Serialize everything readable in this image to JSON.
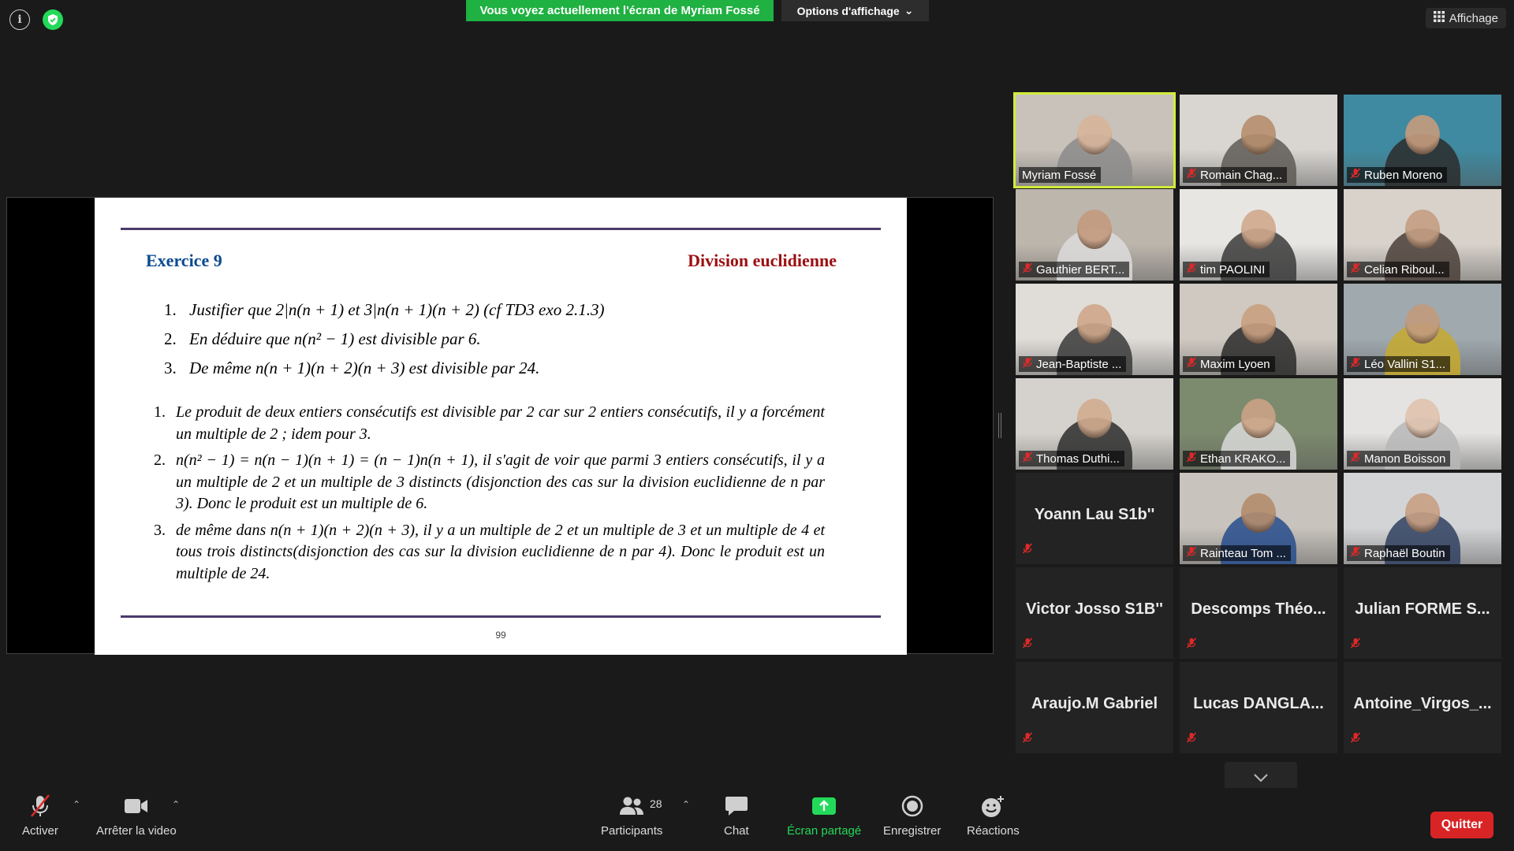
{
  "top": {
    "banner": "Vous voyez actuellement l'écran de Myriam Fossé",
    "view_options": "Options d'affichage",
    "view_button": "Affichage"
  },
  "slide": {
    "title": "Exercice 9",
    "topic": "Division euclidienne",
    "questions": [
      {
        "num": "1.",
        "text": "Justifier que 2|n(n + 1) et 3|n(n + 1)(n + 2) (cf TD3 exo 2.1.3)"
      },
      {
        "num": "2.",
        "text": "En déduire que n(n² − 1) est divisible par 6."
      },
      {
        "num": "3.",
        "text": "De même n(n + 1)(n + 2)(n + 3) est divisible par 24."
      }
    ],
    "answers": [
      {
        "num": "1.",
        "text": "Le produit de deux entiers consécutifs est divisible par 2 car sur 2 entiers consécutifs, il y a forcément un multiple de 2 ; idem pour 3."
      },
      {
        "num": "2.",
        "text": "n(n² − 1) = n(n − 1)(n + 1) = (n − 1)n(n + 1), il s'agit de voir que parmi 3 entiers consécutifs, il y a un multiple de 2 et un multiple de 3 distincts (disjonction des cas sur la division euclidienne de n par 3). Donc le produit est un multiple de 6."
      },
      {
        "num": "3.",
        "text": "de même dans n(n + 1)(n + 2)(n + 3), il y a un multiple de 2 et un multiple de 3 et un multiple de 4 et tous trois distincts(disjonction des cas sur la division euclidienne de n par 4). Donc le produit est un multiple de 24."
      }
    ],
    "page": "99"
  },
  "participants": [
    {
      "name": "Myriam Fossé",
      "video": true,
      "muted": false,
      "active": true,
      "bg": "#c9c2ba",
      "shirt": "#8b8b8b",
      "skin": "#d8b49a"
    },
    {
      "name": "Romain Chag...",
      "video": true,
      "muted": true,
      "active": false,
      "bg": "#d9d6d2",
      "shirt": "#5e5a55",
      "skin": "#b68e6e"
    },
    {
      "name": "Ruben Moreno",
      "video": true,
      "muted": true,
      "active": false,
      "bg": "#3f8aa0",
      "shirt": "#2c2c2c",
      "skin": "#c69c7d"
    },
    {
      "name": "Gauthier BERT...",
      "video": true,
      "muted": true,
      "active": false,
      "bg": "#bdb6ad",
      "shirt": "#dcdcdc",
      "skin": "#c39a7e"
    },
    {
      "name": "tim PAOLINI",
      "video": true,
      "muted": true,
      "active": false,
      "bg": "#e8e6e3",
      "shirt": "#3a3a3a",
      "skin": "#d0a98c"
    },
    {
      "name": "Celian Riboul...",
      "video": true,
      "muted": true,
      "active": false,
      "bg": "#d8d2cb",
      "shirt": "#4a3f38",
      "skin": "#c49e82"
    },
    {
      "name": "Jean-Baptiste ...",
      "video": true,
      "muted": true,
      "active": false,
      "bg": "#e0ddd9",
      "shirt": "#3a3a3a",
      "skin": "#cfa78a"
    },
    {
      "name": "Maxim Lyoen",
      "video": true,
      "muted": true,
      "active": false,
      "bg": "#cfc9c1",
      "shirt": "#2a2a2a",
      "skin": "#c9a080"
    },
    {
      "name": "Léo Vallini S1...",
      "video": true,
      "muted": true,
      "active": false,
      "bg": "#9fa9ae",
      "shirt": "#c7a92e",
      "skin": "#c29a7c"
    },
    {
      "name": "Thomas Duthi...",
      "video": true,
      "muted": true,
      "active": false,
      "bg": "#d5d2cd",
      "shirt": "#2d2d2d",
      "skin": "#d2ac90"
    },
    {
      "name": "Ethan KRAKO...",
      "video": true,
      "muted": true,
      "active": false,
      "bg": "#7c8a6e",
      "shirt": "#d9d9d9",
      "skin": "#cba385"
    },
    {
      "name": "Manon Boisson",
      "video": true,
      "muted": true,
      "active": false,
      "bg": "#e4e3e1",
      "shirt": "#b7b7b7",
      "skin": "#dfc3ae"
    },
    {
      "name": "Yoann Lau S1b''",
      "video": false,
      "muted": true
    },
    {
      "name": "Rainteau Tom ...",
      "video": true,
      "muted": true,
      "active": false,
      "bg": "#c8c3bc",
      "shirt": "#274c8c",
      "skin": "#b48c6c"
    },
    {
      "name": "Raphaël Boutin",
      "video": true,
      "muted": true,
      "active": false,
      "bg": "#d3d4d6",
      "shirt": "#2f3f5f",
      "skin": "#c8a083"
    },
    {
      "name": "Victor Josso S1B''",
      "video": false,
      "muted": true
    },
    {
      "name": "Descomps Théo...",
      "video": false,
      "muted": true
    },
    {
      "name": "Julian FORME S...",
      "video": false,
      "muted": true
    },
    {
      "name": "Araujo.M Gabriel",
      "video": false,
      "muted": true
    },
    {
      "name": "Lucas DANGLA...",
      "video": false,
      "muted": true
    },
    {
      "name": "Antoine_Virgos_...",
      "video": false,
      "muted": true
    }
  ],
  "toolbar": {
    "unmute": "Activer",
    "stop_video": "Arrêter la video",
    "participants": "Participants",
    "participants_count": "28",
    "chat": "Chat",
    "share": "Écran partagé",
    "record": "Enregistrer",
    "reactions": "Réactions",
    "quit": "Quitter"
  },
  "colors": {
    "banner_green": "#1fb141",
    "active_speaker": "#d2ec3c",
    "quit_red": "#d92426",
    "mute_red": "#e02828",
    "share_green": "#23d959",
    "slide_title_blue": "#0b4a8f",
    "slide_topic_red": "#9c0f12"
  }
}
